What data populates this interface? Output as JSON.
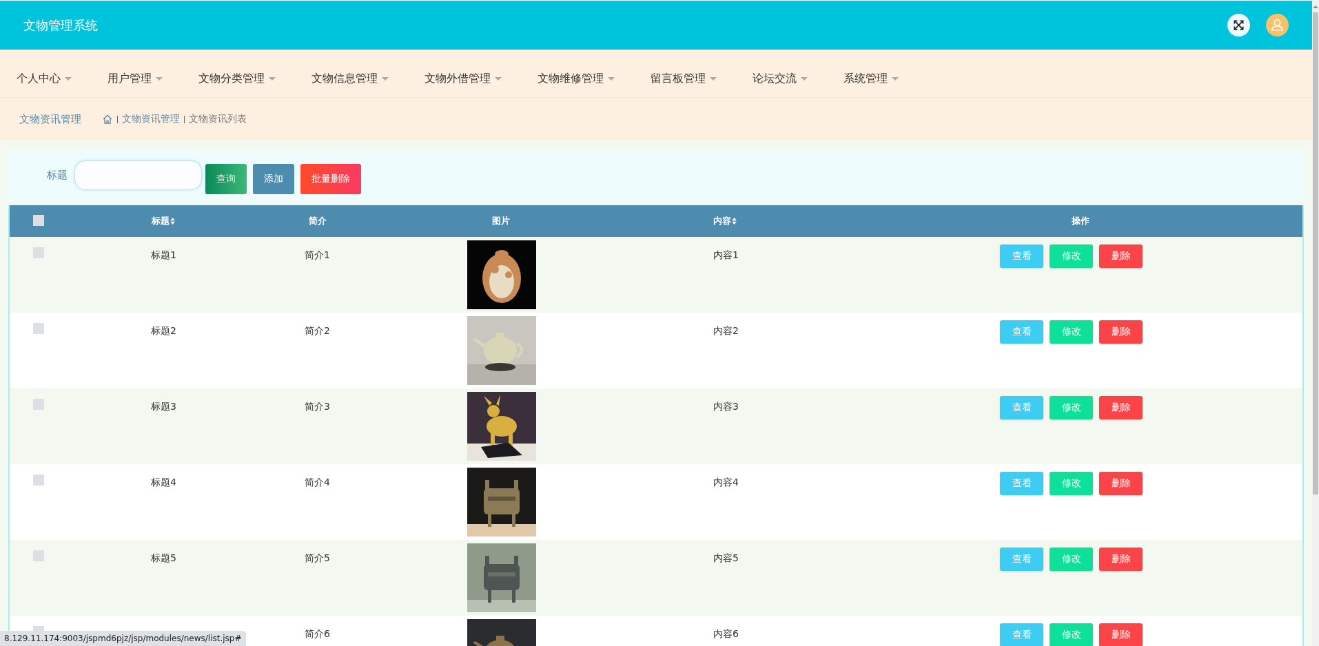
{
  "header": {
    "title": "文物管理系统"
  },
  "nav": [
    {
      "label": "个人中心"
    },
    {
      "label": "用户管理"
    },
    {
      "label": "文物分类管理"
    },
    {
      "label": "文物信息管理"
    },
    {
      "label": "文物外借管理"
    },
    {
      "label": "文物维修管理"
    },
    {
      "label": "留言板管理"
    },
    {
      "label": "论坛交流"
    },
    {
      "label": "系统管理"
    }
  ],
  "breadcrumb": {
    "section": "文物资讯管理",
    "path": [
      "文物资讯管理",
      "文物资讯列表"
    ]
  },
  "search": {
    "label": "标题",
    "buttons": [
      {
        "kind": "search",
        "label": "查询"
      },
      {
        "kind": "add",
        "label": "添加"
      },
      {
        "kind": "bulk-delete",
        "label": "批量删除"
      }
    ]
  },
  "table": {
    "select_all": {
      "checked": false
    },
    "columns": [
      {
        "label": "标题",
        "sortable": true
      },
      {
        "label": "简介",
        "sortable": false
      },
      {
        "label": "图片",
        "sortable": false
      },
      {
        "label": "内容",
        "sortable": true
      },
      {
        "label": "操作",
        "sortable": false
      }
    ],
    "rows": [
      {
        "checked": false,
        "title": "标题1",
        "intro": "简介1",
        "content": "内容1",
        "actions": [
          {
            "kind": "view",
            "label": "查看"
          },
          {
            "kind": "edit",
            "label": "修改"
          },
          {
            "kind": "delete",
            "label": "删除"
          }
        ]
      },
      {
        "checked": false,
        "title": "标题2",
        "intro": "简介2",
        "content": "内容2",
        "actions": [
          {
            "kind": "view",
            "label": "查看"
          },
          {
            "kind": "edit",
            "label": "修改"
          },
          {
            "kind": "delete",
            "label": "删除"
          }
        ]
      },
      {
        "checked": false,
        "title": "标题3",
        "intro": "简介3",
        "content": "内容3",
        "actions": [
          {
            "kind": "view",
            "label": "查看"
          },
          {
            "kind": "edit",
            "label": "修改"
          },
          {
            "kind": "delete",
            "label": "删除"
          }
        ]
      },
      {
        "checked": false,
        "title": "标题4",
        "intro": "简介4",
        "content": "内容4",
        "actions": [
          {
            "kind": "view",
            "label": "查看"
          },
          {
            "kind": "edit",
            "label": "修改"
          },
          {
            "kind": "delete",
            "label": "删除"
          }
        ]
      },
      {
        "checked": false,
        "title": "标题5",
        "intro": "简介5",
        "content": "内容5",
        "actions": [
          {
            "kind": "view",
            "label": "查看"
          },
          {
            "kind": "edit",
            "label": "修改"
          },
          {
            "kind": "delete",
            "label": "删除"
          }
        ]
      },
      {
        "checked": false,
        "intro": "简介6",
        "content": "内容6",
        "actions": [
          {
            "kind": "view",
            "label": "查看"
          },
          {
            "kind": "edit",
            "label": "修改"
          },
          {
            "kind": "delete",
            "label": "删除"
          }
        ]
      }
    ]
  },
  "status_url": "8.129.11.174:9003/jspmd6pjz/jsp/modules/news/list.jsp#"
}
